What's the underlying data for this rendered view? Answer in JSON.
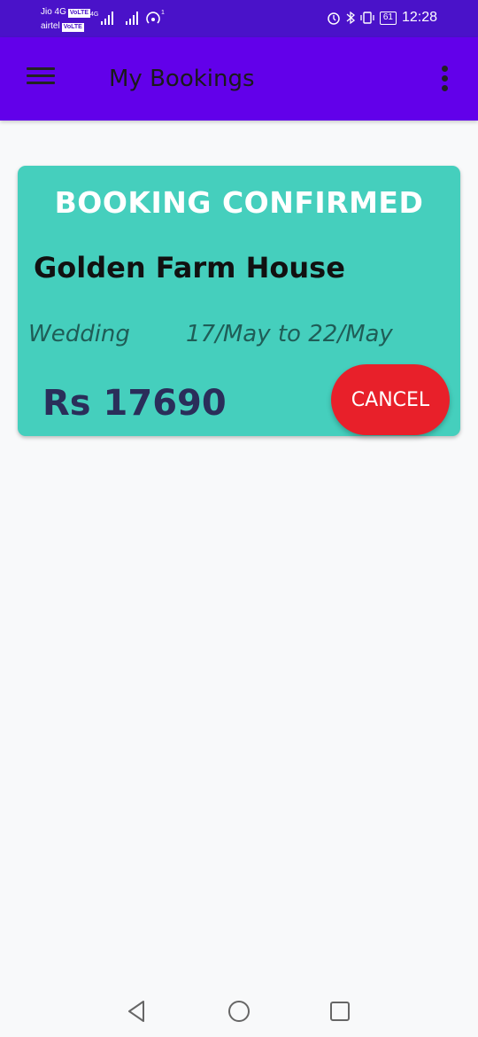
{
  "status_bar": {
    "carrier1": "Jio 4G",
    "carrier2": "airtel",
    "volte": "VoLTE",
    "net_type": "4G",
    "hotspot_count": "1",
    "battery": "61",
    "time": "12:28"
  },
  "app_bar": {
    "title": "My Bookings"
  },
  "booking": {
    "status": "BOOKING CONFIRMED",
    "venue": "Golden Farm House",
    "event_type": "Wedding",
    "dates": "17/May to 22/May",
    "price": "Rs 17690",
    "cancel_label": "CANCEL"
  },
  "colors": {
    "status_bar": "#4a12c9",
    "app_bar": "#6200ea",
    "card": "#45cfbd",
    "cancel": "#e8202a"
  },
  "icons": {
    "menu": "hamburger-icon",
    "overflow": "more-vert-icon",
    "back": "triangle-back-icon",
    "home": "circle-home-icon",
    "recents": "square-recents-icon"
  }
}
